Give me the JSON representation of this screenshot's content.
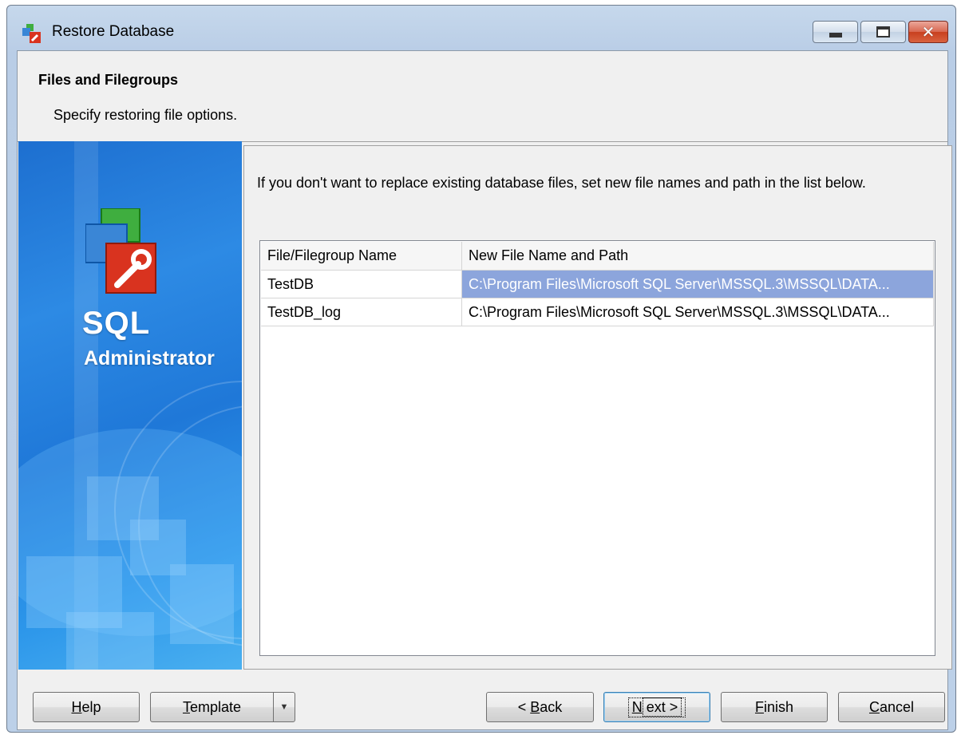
{
  "window": {
    "title": "Restore Database",
    "icon": "sql-administrator-app-icon"
  },
  "header": {
    "title": "Files and Filegroups",
    "subtitle": "Specify restoring file options."
  },
  "banner": {
    "product_line1": "SQL",
    "product_line2": "Administrator"
  },
  "main": {
    "instruction": "If you don't want to replace existing database files, set new file names and path in the list below.",
    "columns": [
      "File/Filegroup Name",
      "New File Name and Path"
    ],
    "rows": [
      {
        "name": "TestDB",
        "path": "C:\\Program Files\\Microsoft SQL Server\\MSSQL.3\\MSSQL\\DATA...",
        "selected": true
      },
      {
        "name": "TestDB_log",
        "path": "C:\\Program Files\\Microsoft SQL Server\\MSSQL.3\\MSSQL\\DATA...",
        "selected": false
      }
    ]
  },
  "footer": {
    "help": {
      "accel": "H",
      "rest": "elp"
    },
    "template": {
      "accel": "T",
      "rest": "emplate"
    },
    "back": {
      "pre": "< ",
      "accel": "B",
      "rest": "ack"
    },
    "next": {
      "accel": "N",
      "rest": "ext >"
    },
    "finish": {
      "accel": "F",
      "rest": "inish"
    },
    "cancel": {
      "accel": "C",
      "rest": "ancel"
    }
  },
  "colors": {
    "selection": "#8ca5dc",
    "banner_blue": "#1f78d8"
  }
}
